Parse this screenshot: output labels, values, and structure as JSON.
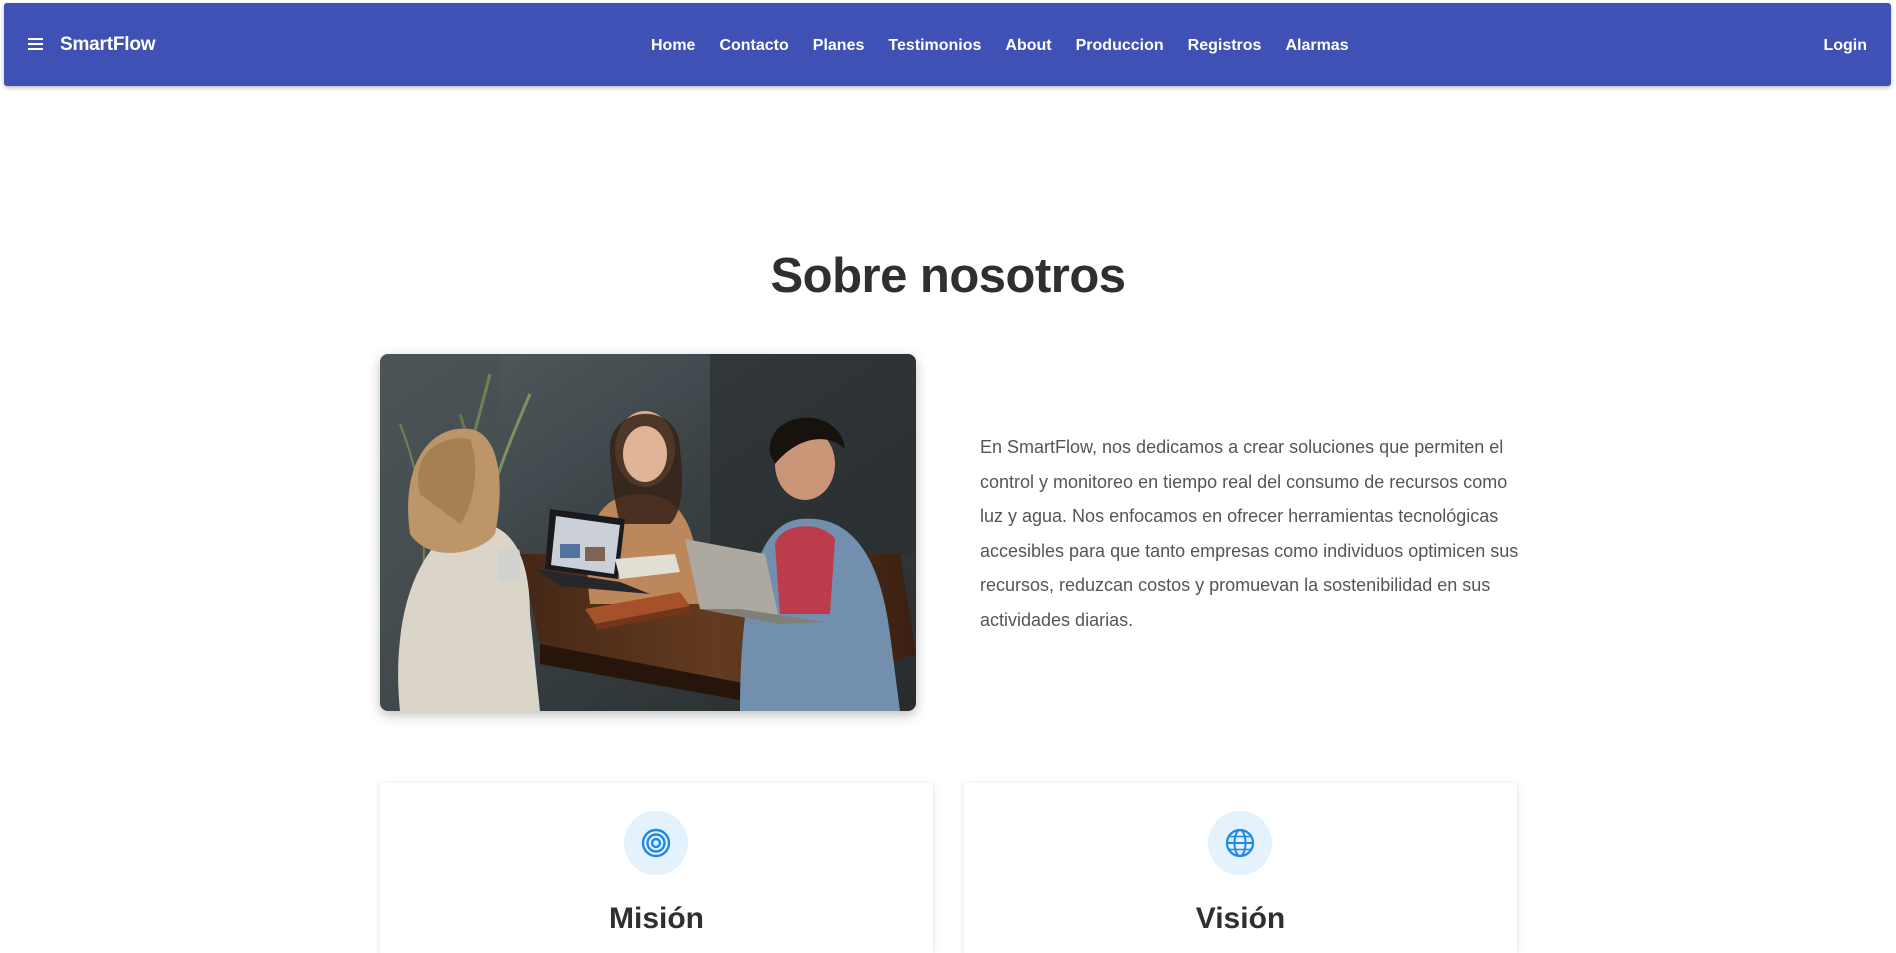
{
  "appbar": {
    "brand": "SmartFlow",
    "menu_icon": "hamburger-menu-icon",
    "nav": [
      "Home",
      "Contacto",
      "Planes",
      "Testimonios",
      "About",
      "Produccion",
      "Registros",
      "Alarmas"
    ],
    "login": "Login",
    "color": "#3f51b5"
  },
  "about": {
    "title": "Sobre nosotros",
    "image_alt": "Tres personas sonriendo alrededor de una mesa de madera con laptops",
    "text": "En SmartFlow, nos dedicamos a crear soluciones que permiten el control y monitoreo en tiempo real del consumo de recursos como luz y agua. Nos enfocamos en ofrecer herramientas tecnológicas accesibles para que tanto empresas como individuos optimicen sus recursos, reduzcan costos y promuevan la sostenibilidad en sus actividades diarias."
  },
  "cards": {
    "mision": {
      "title": "Misión",
      "icon": "target-icon"
    },
    "vision": {
      "title": "Visión",
      "icon": "globe-icon"
    },
    "icon_color": "#1e88e5",
    "icon_bg": "#e3f2fd"
  }
}
